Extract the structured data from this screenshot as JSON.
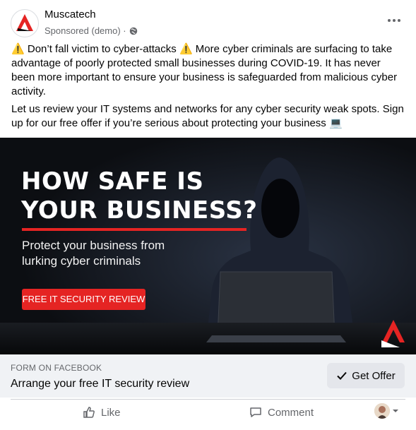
{
  "post": {
    "page_name": "Muscatech",
    "sponsored_label": "Sponsored (demo) ·",
    "text_paragraph_1_part1": "Don’t fall victim to cyber-attacks",
    "text_paragraph_1_part2": "More cyber criminals are surfacing to take advantage of poorly protected small businesses during COVID-19. It has never been more important to ensure your business is safeguarded from malicious cyber activity.",
    "text_paragraph_2": "Let us review your IT systems and networks for any cyber security weak spots. Sign up for our free offer if you’re serious about protecting your business 💻",
    "icons": [
      "globe-icon",
      "more-icon",
      "warning-icon",
      "laptop-emoji",
      "like-icon",
      "comment-icon",
      "check-icon",
      "chevron-down-icon"
    ]
  },
  "creative": {
    "headline": "HOW SAFE IS\nYOUR BUSINESS?",
    "subtext": "Protect your business from\nlurking cyber criminals",
    "cta": "FREE IT SECURITY REVIEW",
    "accent_color": "#e52423"
  },
  "form": {
    "label": "FORM ON FACEBOOK",
    "title": "Arrange your free IT security review",
    "button_label": "Get Offer"
  },
  "actions": {
    "like_label": "Like",
    "comment_label": "Comment"
  }
}
